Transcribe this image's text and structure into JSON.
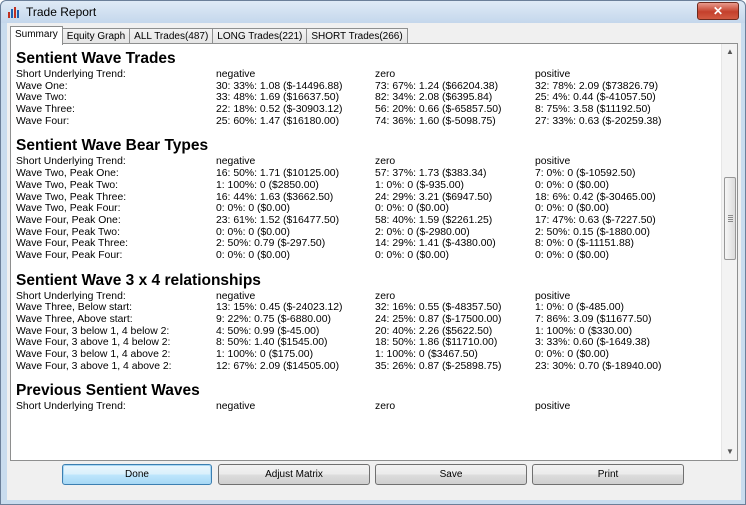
{
  "window": {
    "title": "Trade Report",
    "close_label": "✕"
  },
  "tabs": [
    {
      "label": "Summary",
      "active": true
    },
    {
      "label": "Equity Graph"
    },
    {
      "label": "ALL Trades(487)"
    },
    {
      "label": "LONG Trades(221)"
    },
    {
      "label": "SHORT Trades(266)"
    }
  ],
  "sections": [
    {
      "title": "Sentient Wave Trades",
      "header": {
        "label": "Short Underlying Trend:",
        "negative": "negative",
        "zero": "zero",
        "positive": "positive"
      },
      "rows": [
        {
          "label": "Wave One:",
          "negative": "30: 33%: 1.08 ($-14496.88)",
          "zero": "73: 67%: 1.24 ($66204.38)",
          "positive": "32: 78%: 2.09 ($73826.79)"
        },
        {
          "label": "Wave Two:",
          "negative": "33: 48%: 1.69 ($16637.50)",
          "zero": "82: 34%: 2.08 ($6395.84)",
          "positive": "25: 4%: 0.44 ($-41057.50)"
        },
        {
          "label": "Wave Three:",
          "negative": "22: 18%: 0.52 ($-30903.12)",
          "zero": "56: 20%: 0.66 ($-65857.50)",
          "positive": "8: 75%: 3.58 ($11192.50)"
        },
        {
          "label": "Wave Four:",
          "negative": "25: 60%: 1.47 ($16180.00)",
          "zero": "74: 36%: 1.60 ($-5098.75)",
          "positive": "27: 33%: 0.63 ($-20259.38)"
        }
      ]
    },
    {
      "title": "Sentient Wave Bear Types",
      "header": {
        "label": "Short Underlying Trend:",
        "negative": "negative",
        "zero": "zero",
        "positive": "positive"
      },
      "rows": [
        {
          "label": "Wave Two, Peak One:",
          "negative": "16: 50%: 1.71 ($10125.00)",
          "zero": "57: 37%: 1.73 ($383.34)",
          "positive": "7: 0%: 0 ($-10592.50)"
        },
        {
          "label": "Wave Two, Peak Two:",
          "negative": "1: 100%: 0 ($2850.00)",
          "zero": "1: 0%: 0 ($-935.00)",
          "positive": "0: 0%: 0 ($0.00)"
        },
        {
          "label": "Wave Two, Peak Three:",
          "negative": "16: 44%: 1.63 ($3662.50)",
          "zero": "24: 29%: 3.21 ($6947.50)",
          "positive": "18: 6%: 0.42 ($-30465.00)"
        },
        {
          "label": "Wave Two, Peak Four:",
          "negative": "0: 0%: 0 ($0.00)",
          "zero": "0: 0%: 0 ($0.00)",
          "positive": "0: 0%: 0 ($0.00)"
        },
        {
          "label": "Wave Four, Peak One:",
          "negative": "23: 61%: 1.52 ($16477.50)",
          "zero": "58: 40%: 1.59 ($2261.25)",
          "positive": "17: 47%: 0.63 ($-7227.50)"
        },
        {
          "label": "Wave Four, Peak Two:",
          "negative": "0: 0%: 0 ($0.00)",
          "zero": "2: 0%: 0 ($-2980.00)",
          "positive": "2: 50%: 0.15 ($-1880.00)"
        },
        {
          "label": "Wave Four, Peak Three:",
          "negative": "2: 50%: 0.79 ($-297.50)",
          "zero": "14: 29%: 1.41 ($-4380.00)",
          "positive": "8: 0%: 0 ($-11151.88)"
        },
        {
          "label": "Wave Four, Peak Four:",
          "negative": "0: 0%: 0 ($0.00)",
          "zero": "0: 0%: 0 ($0.00)",
          "positive": "0: 0%: 0 ($0.00)"
        }
      ]
    },
    {
      "title": "Sentient Wave 3 x 4 relationships",
      "header": {
        "label": "Short Underlying Trend:",
        "negative": "negative",
        "zero": "zero",
        "positive": "positive"
      },
      "rows": [
        {
          "label": "Wave Three, Below start:",
          "negative": "13: 15%: 0.45 ($-24023.12)",
          "zero": "32: 16%: 0.55 ($-48357.50)",
          "positive": "1: 0%: 0 ($-485.00)"
        },
        {
          "label": "Wave Three, Above start:",
          "negative": "9: 22%: 0.75 ($-6880.00)",
          "zero": "24: 25%: 0.87 ($-17500.00)",
          "positive": "7: 86%: 3.09 ($11677.50)"
        },
        {
          "label": "Wave Four, 3 below 1, 4 below 2:",
          "negative": "4: 50%: 0.99 ($-45.00)",
          "zero": "20: 40%: 2.26 ($5622.50)",
          "positive": "1: 100%: 0 ($330.00)"
        },
        {
          "label": "Wave Four, 3 above 1, 4 below 2:",
          "negative": "8: 50%: 1.40 ($1545.00)",
          "zero": "18: 50%: 1.86 ($11710.00)",
          "positive": "3: 33%: 0.60 ($-1649.38)"
        },
        {
          "label": "Wave Four, 3 below 1, 4 above 2:",
          "negative": "1: 100%: 0 ($175.00)",
          "zero": "1: 100%: 0 ($3467.50)",
          "positive": "0: 0%: 0 ($0.00)"
        },
        {
          "label": "Wave Four, 3 above 1, 4 above 2:",
          "negative": "12: 67%: 2.09 ($14505.00)",
          "zero": "35: 26%: 0.87 ($-25898.75)",
          "positive": "23: 30%: 0.70 ($-18940.00)"
        }
      ]
    },
    {
      "title": "Previous Sentient Waves",
      "header": {
        "label": "Short Underlying Trend:",
        "negative": "negative",
        "zero": "zero",
        "positive": "positive"
      },
      "rows": []
    }
  ],
  "buttons": {
    "done": "Done",
    "adjust_matrix": "Adjust Matrix",
    "save": "Save",
    "print": "Print"
  },
  "scrollbar": {
    "up_arrow": "▲",
    "down_arrow": "▼"
  }
}
